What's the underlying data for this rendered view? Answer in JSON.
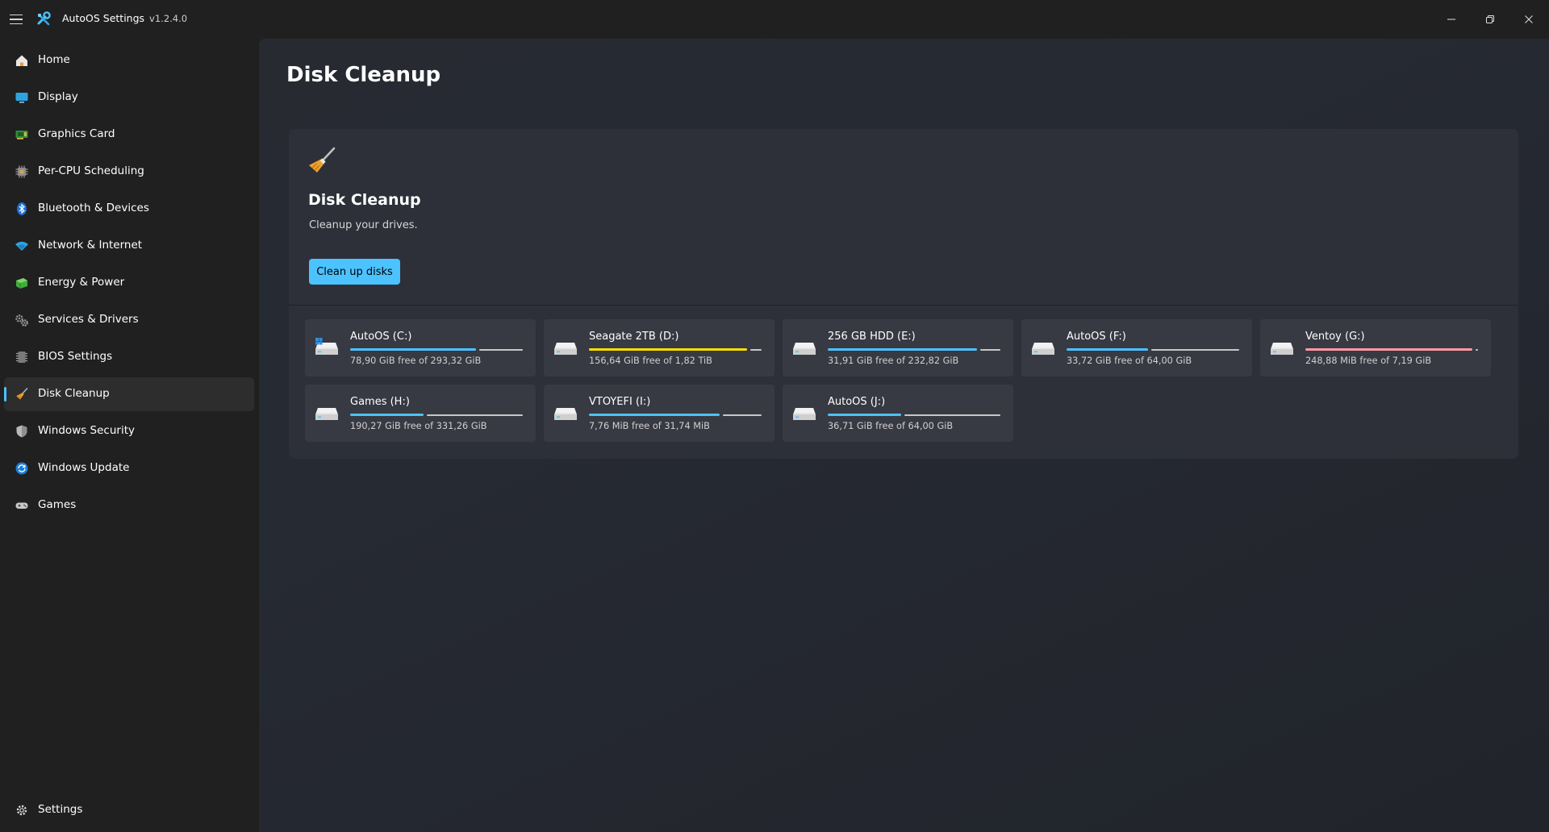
{
  "app": {
    "title": "AutoOS Settings",
    "version": "v1.2.4.0",
    "accent_color": "#4cc2ff"
  },
  "sidebar": {
    "items": [
      {
        "label": "Home",
        "icon": "home-icon"
      },
      {
        "label": "Display",
        "icon": "display-icon"
      },
      {
        "label": "Graphics Card",
        "icon": "graphics-card-icon"
      },
      {
        "label": "Per-CPU Scheduling",
        "icon": "cpu-icon"
      },
      {
        "label": "Bluetooth & Devices",
        "icon": "bluetooth-icon"
      },
      {
        "label": "Network & Internet",
        "icon": "wifi-icon"
      },
      {
        "label": "Energy & Power",
        "icon": "battery-icon"
      },
      {
        "label": "Services & Drivers",
        "icon": "gears-icon"
      },
      {
        "label": "BIOS Settings",
        "icon": "chip-icon"
      },
      {
        "label": "Disk Cleanup",
        "icon": "broom-icon",
        "selected": true
      },
      {
        "label": "Windows Security",
        "icon": "shield-icon"
      },
      {
        "label": "Windows Update",
        "icon": "update-icon"
      },
      {
        "label": "Games",
        "icon": "gamepad-icon"
      }
    ],
    "footer": {
      "label": "Settings",
      "icon": "gear-icon"
    }
  },
  "page": {
    "title": "Disk Cleanup",
    "hero": {
      "title": "Disk Cleanup",
      "description": "Cleanup your drives.",
      "button_label": "Clean up disks",
      "icon": "broom-icon"
    }
  },
  "drives": [
    {
      "name": "AutoOS (C:)",
      "free_text": "78,90 GiB free of 293,32 GiB",
      "used_fraction": 0.731,
      "bar_color": "#4cc2ff",
      "icon": "system-drive-icon"
    },
    {
      "name": "Seagate 2TB (D:)",
      "free_text": "156,64 GiB free of 1,82 TiB",
      "used_fraction": 0.916,
      "bar_color": "#fce100",
      "icon": "drive-icon"
    },
    {
      "name": "256 GB HDD (E:)",
      "free_text": "31,91 GiB free of 232,82 GiB",
      "used_fraction": 0.863,
      "bar_color": "#4cc2ff",
      "icon": "drive-icon"
    },
    {
      "name": "AutoOS (F:)",
      "free_text": "33,72 GiB free of 64,00 GiB",
      "used_fraction": 0.473,
      "bar_color": "#4cc2ff",
      "icon": "drive-icon"
    },
    {
      "name": "Ventoy (G:)",
      "free_text": "248,88 MiB free of 7,19 GiB",
      "used_fraction": 0.966,
      "bar_color": "#ff99a4",
      "icon": "drive-icon"
    },
    {
      "name": "Games (H:)",
      "free_text": "190,27 GiB free of 331,26 GiB",
      "used_fraction": 0.426,
      "bar_color": "#4cc2ff",
      "icon": "drive-icon"
    },
    {
      "name": "VTOYEFI (I:)",
      "free_text": "7,76 MiB free of 31,74 MiB",
      "used_fraction": 0.755,
      "bar_color": "#4cc2ff",
      "icon": "drive-icon"
    },
    {
      "name": "AutoOS (J:)",
      "free_text": "36,71 GiB free of 64,00 GiB",
      "used_fraction": 0.426,
      "bar_color": "#4cc2ff",
      "icon": "drive-icon"
    }
  ]
}
